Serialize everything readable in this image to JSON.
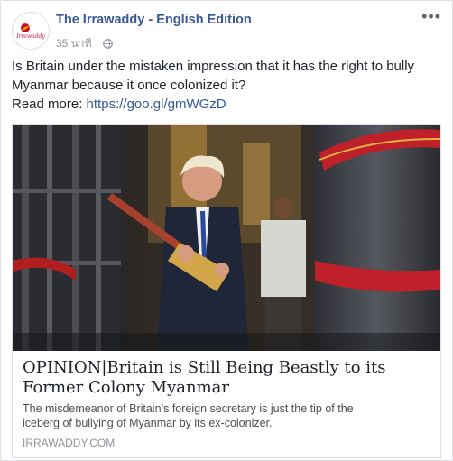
{
  "post": {
    "page_name": "The Irrawaddy - English Edition",
    "timestamp": "35 นาที",
    "separator": "·",
    "audience_icon": "globe-icon",
    "more_icon": "more-options-icon",
    "more_label": "•••",
    "logo_text": "The Irrawaddy"
  },
  "message": {
    "text": "Is Britain under the mistaken impression that it has the right to bully Myanmar because it once colonized it?",
    "read_more_label": "Read more:",
    "link": "https://goo.gl/gmWGzD"
  },
  "link_preview": {
    "title_line1": "OPINION|Britain is Still Being Beastly to its",
    "title_line2": "Former Colony Myanmar",
    "description_line1": "The misdemeanor of Britain’s foreign secretary is just the tip of the",
    "description_line2": "iceberg of bullying of Myanmar by its ex-colonizer.",
    "domain": "IRRAWADDY.COM"
  },
  "colors": {
    "link_blue": "#365899",
    "text": "#1d2129",
    "meta_gray": "#90949c"
  }
}
